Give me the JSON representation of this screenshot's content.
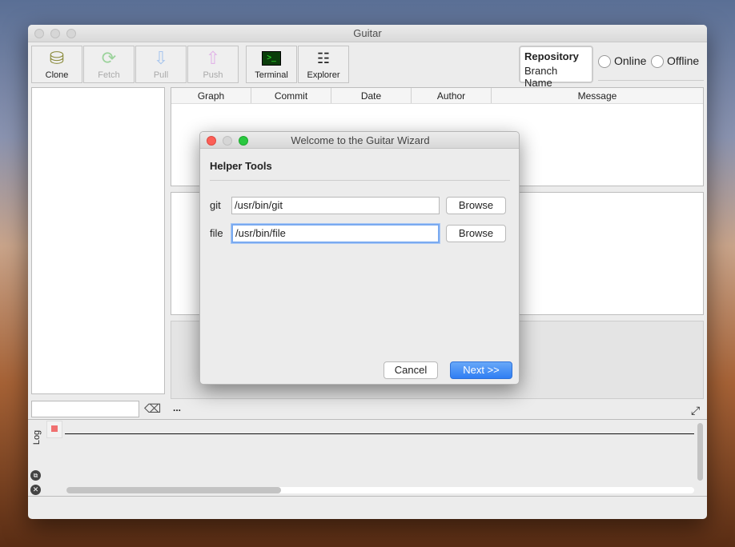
{
  "window": {
    "title": "Guitar"
  },
  "toolbar": [
    {
      "label": "Clone",
      "icon": "database-icon",
      "enabled": true
    },
    {
      "label": "Fetch",
      "icon": "refresh-icon",
      "enabled": false
    },
    {
      "label": "Pull",
      "icon": "arrow-down-icon",
      "enabled": false
    },
    {
      "label": "Push",
      "icon": "arrow-up-icon",
      "enabled": false
    },
    {
      "label": "Terminal",
      "icon": "terminal-icon",
      "enabled": true
    },
    {
      "label": "Explorer",
      "icon": "folder-list-icon",
      "enabled": true
    }
  ],
  "repo": {
    "title": "Repository",
    "branch": "Branch Name"
  },
  "mode": {
    "online": "Online",
    "offline": "Offline"
  },
  "table": {
    "columns": [
      "Graph",
      "Commit",
      "Date",
      "Author",
      "Message"
    ]
  },
  "more": "...",
  "log": {
    "label": "Log"
  },
  "dialog": {
    "title": "Welcome to the Guitar Wizard",
    "section": "Helper Tools",
    "fields": [
      {
        "label": "git",
        "value": "/usr/bin/git",
        "button": "Browse"
      },
      {
        "label": "file",
        "value": "/usr/bin/file",
        "button": "Browse"
      }
    ],
    "cancel": "Cancel",
    "next": "Next >>"
  },
  "colors": {
    "accent": "#3b8cf5"
  }
}
